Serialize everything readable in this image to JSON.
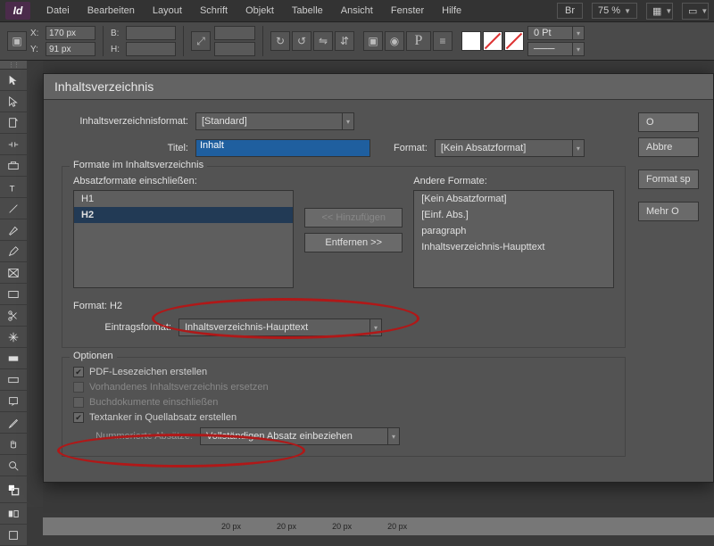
{
  "app": {
    "logo": "Id"
  },
  "menu": {
    "items": [
      "Datei",
      "Bearbeiten",
      "Layout",
      "Schrift",
      "Objekt",
      "Tabelle",
      "Ansicht",
      "Fenster",
      "Hilfe"
    ],
    "right": {
      "br": "Br",
      "zoom": "75 %"
    }
  },
  "controlbar": {
    "x_label": "X:",
    "x_val": "170 px",
    "y_label": "Y:",
    "y_val": "91 px",
    "w_label": "B:",
    "w_val": "",
    "h_label": "H:",
    "h_val": "",
    "pt_label": "0 Pt",
    "P_glyph": "P"
  },
  "dialog": {
    "title": "Inhaltsverzeichnis",
    "format_label": "Inhaltsverzeichnisformat:",
    "format_value": "[Standard]",
    "title_label": "Titel:",
    "title_value": "Inhalt",
    "format2_label": "Format:",
    "format2_value": "[Kein Absatzformat]",
    "fs1_legend": "Formate im Inhaltsverzeichnis",
    "include_label": "Absatzformate einschließen:",
    "include_list": [
      "H1",
      "H2"
    ],
    "include_selected": "H2",
    "other_label": "Andere Formate:",
    "other_list": [
      "[Kein Absatzformat]",
      "[Einf. Abs.]",
      "paragraph",
      "Inhaltsverzeichnis-Haupttext"
    ],
    "btn_add": "<< Hinzufügen",
    "btn_remove": "Entfernen >>",
    "format_h2": "Format: H2",
    "entry_label": "Eintragsformat:",
    "entry_value": "Inhaltsverzeichnis-Haupttext",
    "opts_legend": "Optionen",
    "opt_pdf": "PDF-Lesezeichen erstellen",
    "opt_replace": "Vorhandenes Inhaltsverzeichnis ersetzen",
    "opt_book": "Buchdokumente einschließen",
    "opt_anchor": "Textanker in Quellabsatz erstellen",
    "numbered_label": "Nummerierte Absätze:",
    "numbered_value": "Vollständigen Absatz einbeziehen",
    "side_ok": "O",
    "side_cancel": "Abbre",
    "side_save": "Format sp",
    "side_more": "Mehr O"
  },
  "bottom": {
    "tick": "20 px"
  }
}
